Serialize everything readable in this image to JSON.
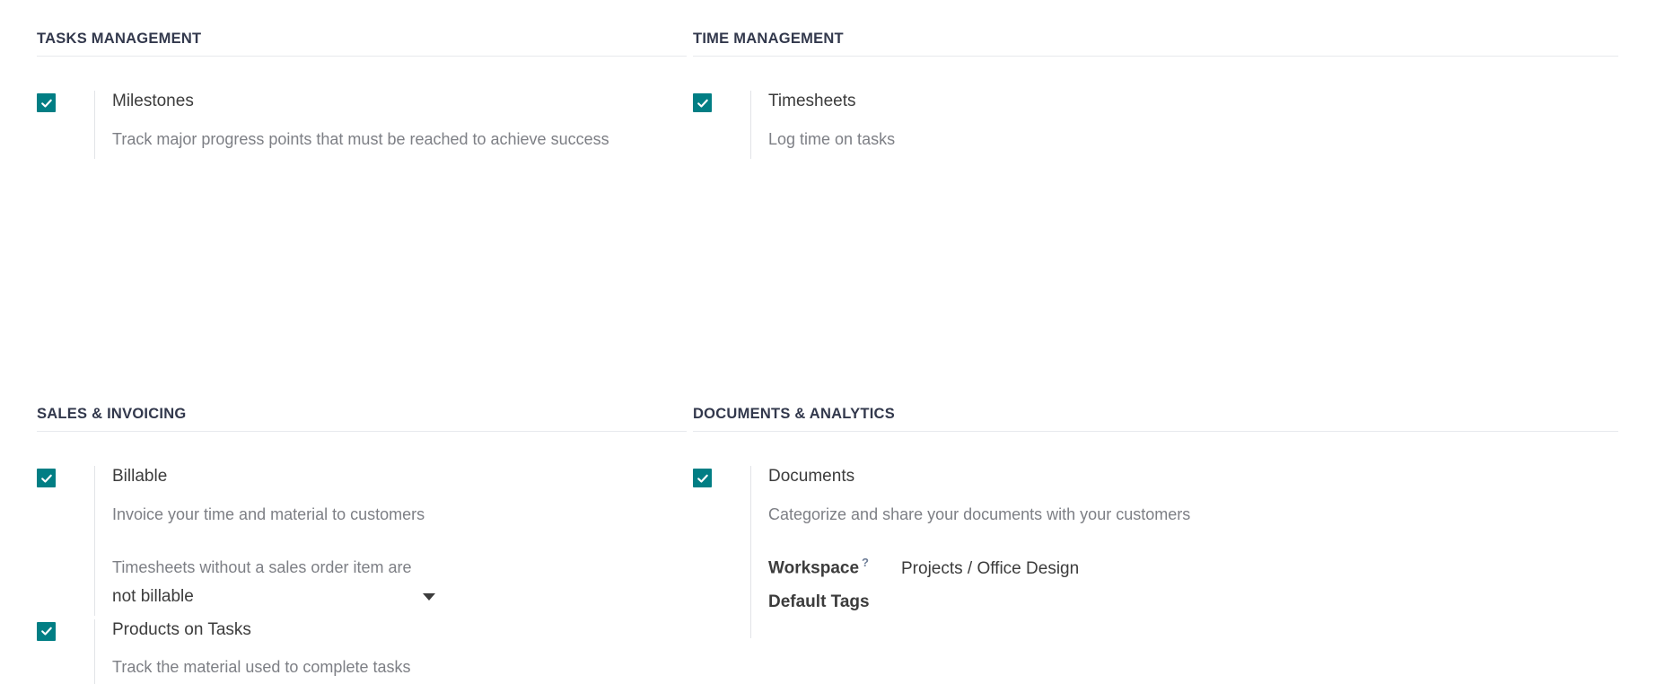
{
  "sections": [
    {
      "key": "tasks_management",
      "title": "TASKS MANAGEMENT",
      "options": [
        {
          "key": "milestones",
          "checked": true,
          "title": "Milestones",
          "description": "Track major progress points that must be reached to achieve success"
        }
      ]
    },
    {
      "key": "time_management",
      "title": "TIME MANAGEMENT",
      "options": [
        {
          "key": "timesheets",
          "checked": true,
          "title": "Timesheets",
          "description": "Log time on tasks"
        }
      ]
    },
    {
      "key": "sales_invoicing",
      "title": "SALES & INVOICING",
      "options": [
        {
          "key": "billable",
          "checked": true,
          "title": "Billable",
          "description": "Invoice your time and material to customers",
          "sub_setting": {
            "label": "Timesheets without a sales order item are",
            "selected": "not billable",
            "icon": "chevron-down-icon"
          }
        },
        {
          "key": "products_on_tasks",
          "checked": true,
          "title": "Products on Tasks",
          "description": "Track the material used to complete tasks"
        }
      ]
    },
    {
      "key": "documents_analytics",
      "title": "DOCUMENTS & ANALYTICS",
      "options": [
        {
          "key": "documents",
          "checked": true,
          "title": "Documents",
          "description": "Categorize and share your documents with your customers",
          "fields": [
            {
              "key": "workspace",
              "label": "Workspace",
              "help": "?",
              "value": "Projects / Office Design"
            },
            {
              "key": "default_tags",
              "label": "Default Tags",
              "help": "",
              "value": ""
            }
          ]
        }
      ]
    }
  ],
  "colors": {
    "checkbox_accent": "#017e84",
    "header_text": "#32384c",
    "body_text": "#3c3c3c",
    "muted_text": "#7d7f85",
    "rule": "#e7e9ed",
    "help_icon": "#6d7d97"
  },
  "icons": {
    "check": "check-icon",
    "caret": "chevron-down-icon",
    "help": "help-question-icon"
  }
}
